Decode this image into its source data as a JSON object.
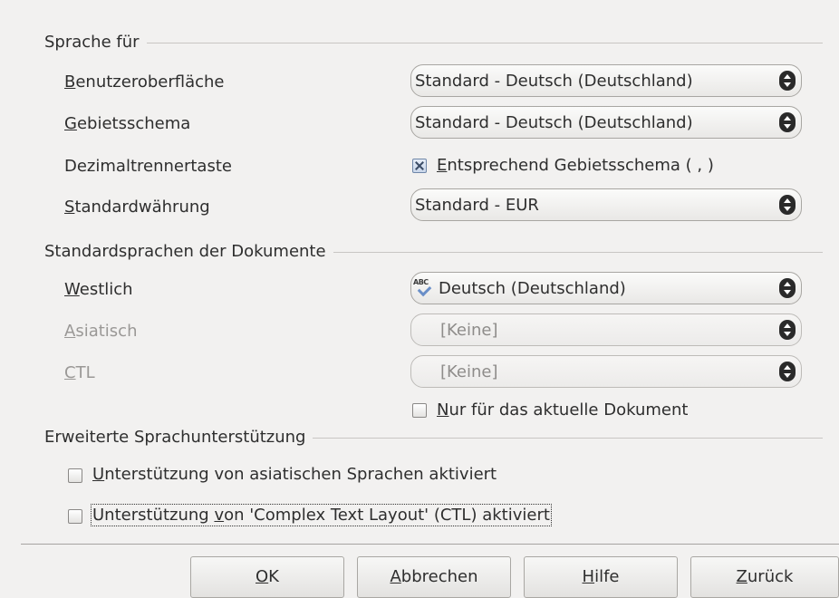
{
  "sections": {
    "language_for": "Sprache für",
    "default_languages": "Standardsprachen der Dokumente",
    "enhanced_support": "Erweiterte Sprachunterstützung"
  },
  "rows": {
    "ui": {
      "mnemonic": "B",
      "rest": "enutzeroberfläche",
      "value": "Standard - Deutsch (Deutschland)"
    },
    "locale": {
      "mnemonic": "G",
      "rest": "ebietsschema",
      "value": "Standard - Deutsch (Deutschland)"
    },
    "decimal": {
      "label": "Dezimaltrennertaste",
      "checkbox_mnemonic": "E",
      "checkbox_rest": "ntsprechend Gebietsschema ( , )",
      "checked": true
    },
    "currency": {
      "mnemonic": "S",
      "rest": "tandardwährung",
      "value": "Standard - EUR"
    },
    "western": {
      "mnemonic": "W",
      "rest": "estlich",
      "value": "Deutsch (Deutschland)",
      "icon": "spellcheck-icon"
    },
    "asian": {
      "mnemonic": "A",
      "rest": "siatisch",
      "value": "[Keine]"
    },
    "ctl": {
      "mnemonic": "C",
      "rest": "TL",
      "value": "[Keine]"
    },
    "current_doc_only": {
      "mnemonic": "N",
      "rest": "ur für das aktuelle Dokument",
      "checked": false
    }
  },
  "enhanced": {
    "asian": {
      "mnemonic": "U",
      "rest": "nterstützung von asiatischen Sprachen aktiviert",
      "checked": false
    },
    "ctl": {
      "pre": "Unterstützung ",
      "mnemonic": "v",
      "rest": "on 'Complex Text Layout' (CTL) aktiviert",
      "checked": false
    }
  },
  "buttons": {
    "ok": {
      "mnemonic": "O",
      "rest": "K"
    },
    "cancel": {
      "mnemonic": "A",
      "rest": "bbrechen"
    },
    "help": {
      "mnemonic": "H",
      "rest": "ilfe"
    },
    "back": {
      "mnemonic": "Z",
      "rest": "urück"
    }
  },
  "colors": {
    "background": "#f2f1f0",
    "disabled_text": "#9a9896",
    "checkbox_check": "#3b4c66"
  }
}
